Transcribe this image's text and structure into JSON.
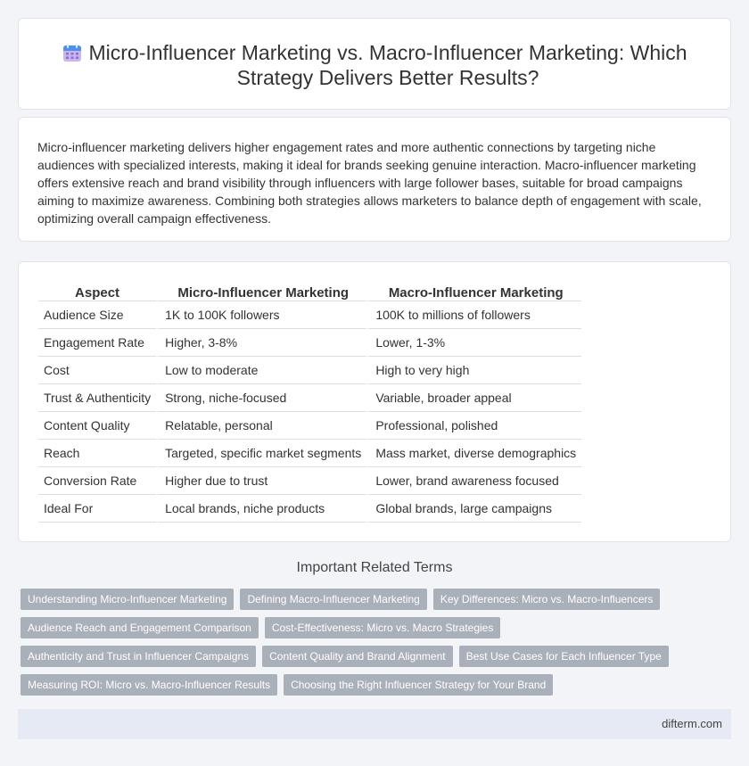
{
  "header": {
    "icon": "calendar-icon",
    "title": "Micro-Influencer Marketing vs. Macro-Influencer Marketing: Which Strategy Delivers Better Results?"
  },
  "summary": "Micro-influencer marketing delivers higher engagement rates and more authentic connections by targeting niche audiences with specialized interests, making it ideal for brands seeking genuine interaction. Macro-influencer marketing offers extensive reach and brand visibility through influencers with large follower bases, suitable for broad campaigns aiming to maximize awareness. Combining both strategies allows marketers to balance depth of engagement with scale, optimizing overall campaign effectiveness.",
  "table": {
    "headers": [
      "Aspect",
      "Micro-Influencer Marketing",
      "Macro-Influencer Marketing"
    ],
    "rows": [
      [
        "Audience Size",
        "1K to 100K followers",
        "100K to millions of followers"
      ],
      [
        "Engagement Rate",
        "Higher, 3-8%",
        "Lower, 1-3%"
      ],
      [
        "Cost",
        "Low to moderate",
        "High to very high"
      ],
      [
        "Trust & Authenticity",
        "Strong, niche-focused",
        "Variable, broader appeal"
      ],
      [
        "Content Quality",
        "Relatable, personal",
        "Professional, polished"
      ],
      [
        "Reach",
        "Targeted, specific market segments",
        "Mass market, diverse demographics"
      ],
      [
        "Conversion Rate",
        "Higher due to trust",
        "Lower, brand awareness focused"
      ],
      [
        "Ideal For",
        "Local brands, niche products",
        "Global brands, large campaigns"
      ]
    ]
  },
  "related": {
    "title": "Important Related Terms",
    "tags": [
      "Understanding Micro-Influencer Marketing",
      "Defining Macro-Influencer Marketing",
      "Key Differences: Micro vs. Macro-Influencers",
      "Audience Reach and Engagement Comparison",
      "Cost-Effectiveness: Micro vs. Macro Strategies",
      "Authenticity and Trust in Influencer Campaigns",
      "Content Quality and Brand Alignment",
      "Best Use Cases for Each Influencer Type",
      "Measuring ROI: Micro vs. Macro-Influencer Results",
      "Choosing the Right Influencer Strategy for Your Brand"
    ]
  },
  "footer": {
    "site": "difterm.com"
  }
}
